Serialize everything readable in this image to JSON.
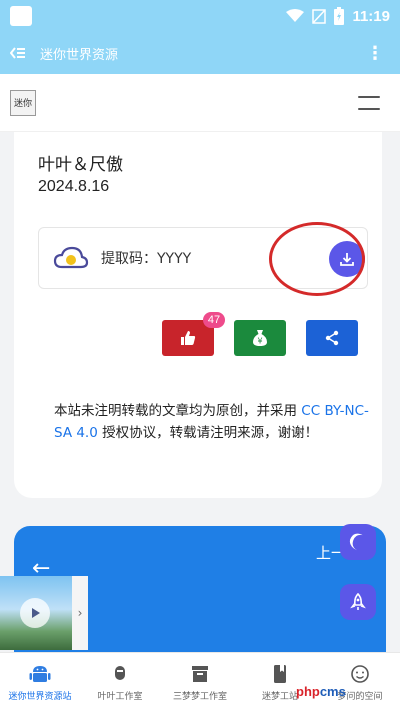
{
  "status_bar": {
    "time": "11:19"
  },
  "app_bar": {
    "title": "迷你世界资源",
    "back_icon": "back-list-icon",
    "menu_label": "⋮"
  },
  "site_header": {
    "logo_text": "迷你"
  },
  "card": {
    "author": "叶叶＆尺傲",
    "date": "2024.8.16",
    "extract_code": "提取码：YYYY",
    "like_count": "47",
    "license_text_before": "本站未注明转载的文章均为原创，并采用",
    "license_link": "CC BY-NC-SA 4.0",
    "license_text_after": "授权协议，转载请注明来源，谢谢！"
  },
  "blue_card": {
    "arrow": "←",
    "next_label": "上一"
  },
  "bottom_nav": {
    "items": [
      {
        "label": "迷你世界资源站",
        "active": true
      },
      {
        "label": "叶叶工作室",
        "active": false
      },
      {
        "label": "三梦梦工作室",
        "active": false
      },
      {
        "label": "迷梦工站",
        "active": false
      },
      {
        "label": "梦问的空间",
        "active": false
      }
    ]
  },
  "watermark": {
    "p1": "php",
    "p2": "cms"
  },
  "colors": {
    "accent": "#5b57e8",
    "top_bar": "#8fd6f7",
    "like": "#c8242b",
    "donate": "#1b8a3d",
    "share": "#1c62d6",
    "annotation": "#d42a2a"
  }
}
